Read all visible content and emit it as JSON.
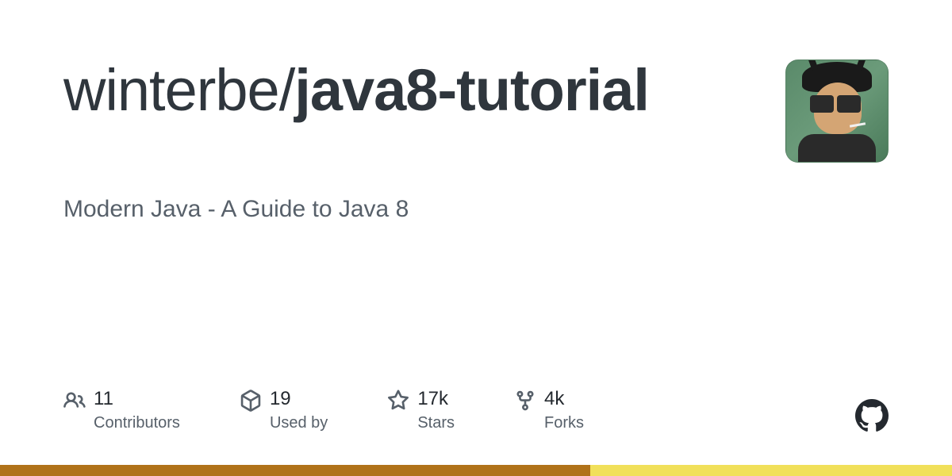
{
  "repo": {
    "owner": "winterbe",
    "slash": "/",
    "name_part1": "java8",
    "dash": "-",
    "name_part2": "tutorial"
  },
  "description": "Modern Java - A Guide to Java 8",
  "stats": {
    "contributors": {
      "value": "11",
      "label": "Contributors"
    },
    "usedby": {
      "value": "19",
      "label": "Used by"
    },
    "stars": {
      "value": "17k",
      "label": "Stars"
    },
    "forks": {
      "value": "4k",
      "label": "Forks"
    }
  },
  "language_bar": {
    "segments": [
      {
        "color": "#b07219",
        "percent": 62
      },
      {
        "color": "#f1e05a",
        "percent": 38
      }
    ]
  }
}
